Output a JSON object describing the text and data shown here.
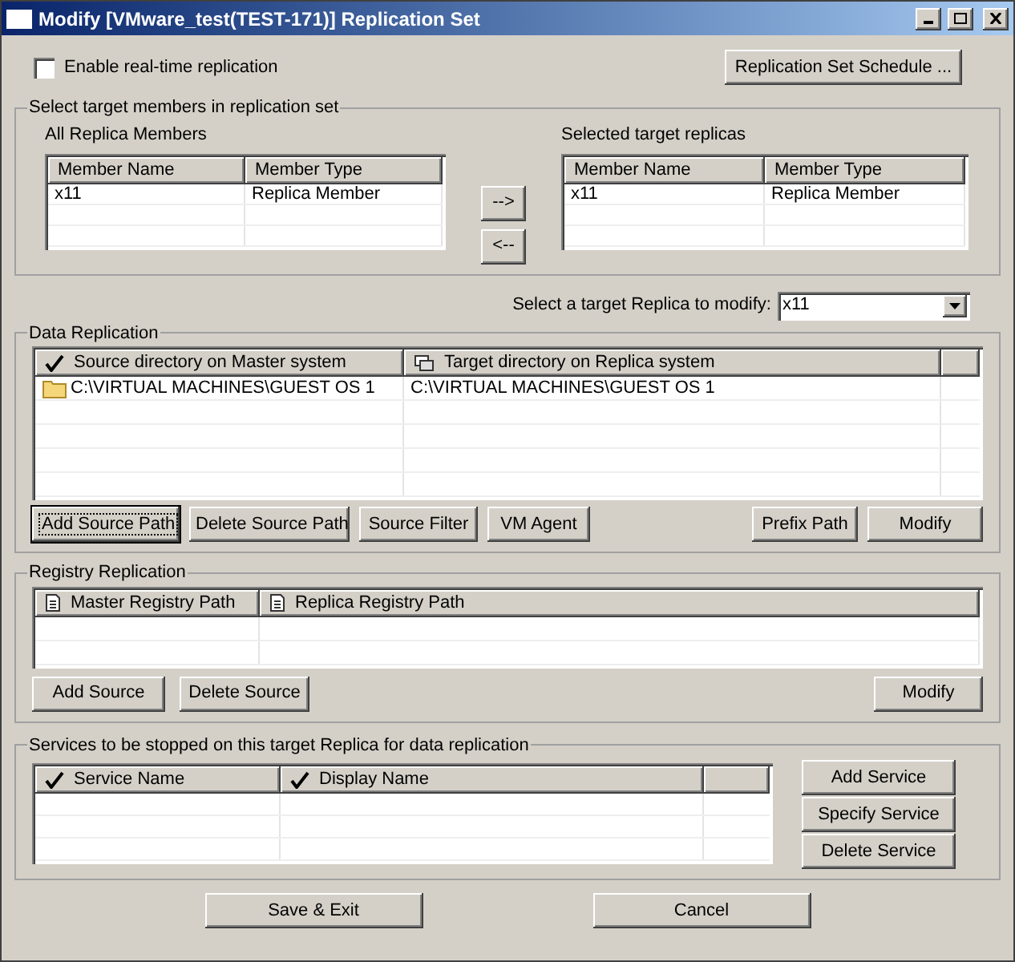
{
  "window": {
    "title": "Modify [VMware_test(TEST-171)] Replication Set"
  },
  "realtime": {
    "label": "Enable real-time replication",
    "checked": false
  },
  "schedule_button": "Replication Set Schedule ...",
  "members": {
    "title": "Select target members in replication set",
    "all": {
      "label": "All Replica Members",
      "columns": [
        "Member Name",
        "Member Type"
      ],
      "rows": [
        [
          "x11",
          "Replica Member"
        ]
      ]
    },
    "move_buttons": [
      "-->",
      "<--"
    ],
    "selected": {
      "label": "Selected target replicas",
      "columns": [
        "Member Name",
        "Member Type"
      ],
      "rows": [
        [
          "x11",
          "Replica Member"
        ]
      ]
    }
  },
  "target_select": {
    "label": "Select a target Replica to modify:",
    "value": "x11"
  },
  "data_replication": {
    "title": "Data Replication",
    "columns": [
      {
        "label": "Source directory on Master system",
        "kind": "check"
      },
      {
        "label": "Target directory on Replica system",
        "kind": "replica"
      }
    ],
    "rows": [
      [
        "C:\\VIRTUAL MACHINES\\GUEST OS 1",
        "C:\\VIRTUAL MACHINES\\GUEST OS 1"
      ]
    ],
    "buttons": [
      {
        "label": "Add Source Path",
        "focused": true
      },
      {
        "label": "Delete Source Path",
        "focused": false
      },
      {
        "label": "Source Filter",
        "focused": false
      },
      {
        "label": "VM Agent",
        "focused": false
      }
    ],
    "right_buttons": [
      "Prefix Path",
      "Modify"
    ]
  },
  "registry": {
    "title": "Registry Replication",
    "columns": [
      {
        "label": "Master Registry Path",
        "kind": "registry"
      },
      {
        "label": "Replica Registry Path",
        "kind": "registry"
      }
    ],
    "buttons": [
      "Add Source",
      "Delete Source"
    ],
    "right_buttons": [
      "Modify"
    ]
  },
  "services": {
    "title": "Services to be stopped on this target Replica for data replication",
    "columns": [
      {
        "label": "Service Name",
        "kind": "check"
      },
      {
        "label": "Display Name",
        "kind": "check"
      }
    ],
    "buttons": [
      "Add Service",
      "Specify Service",
      "Delete Service"
    ]
  },
  "footer_buttons": [
    "Save & Exit",
    "Cancel"
  ]
}
